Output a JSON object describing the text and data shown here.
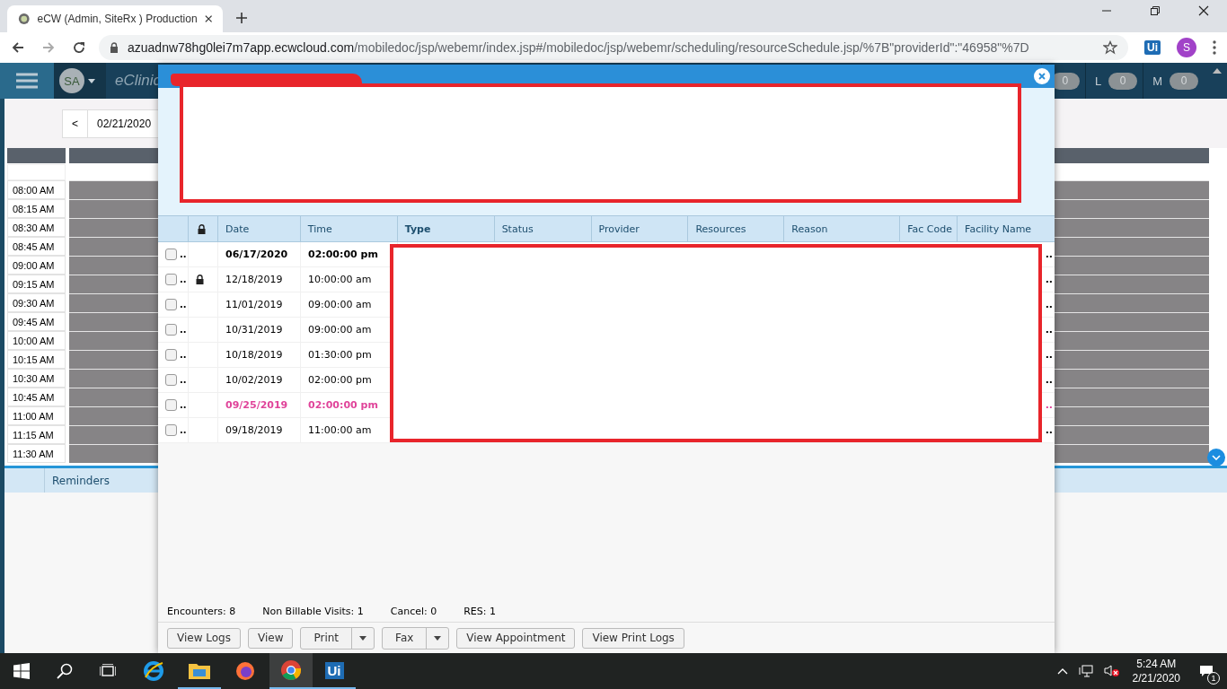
{
  "browser": {
    "tab_title": "eCW (Admin, SiteRx ) Production",
    "url_domain": "azuadnw78hg0lei7m7app.ecwcloud.com",
    "url_path": "/mobiledoc/jsp/webemr/index.jsp#/mobiledoc/jsp/webemr/scheduling/resourceSchedule.jsp/%7B\"providerId\":\"46958\"%7D",
    "extension_label": "Ui",
    "profile_initial": "S"
  },
  "app_header": {
    "user_initials": "SA",
    "product_name": "eClinic",
    "counters": [
      {
        "value": "0"
      },
      {
        "label": "L",
        "value": "0"
      },
      {
        "label": "M",
        "value": "0"
      }
    ]
  },
  "schedule": {
    "prev_button": "<",
    "date": "02/21/2020",
    "times": [
      "08:00 AM",
      "08:15 AM",
      "08:30 AM",
      "08:45 AM",
      "09:00 AM",
      "09:15 AM",
      "09:30 AM",
      "09:45 AM",
      "10:00 AM",
      "10:15 AM",
      "10:30 AM",
      "10:45 AM",
      "11:00 AM",
      "11:15 AM",
      "11:30 AM"
    ]
  },
  "reminders": {
    "heading": "Reminders"
  },
  "dialog": {
    "columns": [
      "Date",
      "Time",
      "Type",
      "Status",
      "Provider",
      "Resources",
      "Reason",
      "Fac Code",
      "Facility Name"
    ],
    "rows": [
      {
        "checked": false,
        "more": "..",
        "locked": false,
        "date": "06/17/2020",
        "time": "02:00:00 pm",
        "bold": true,
        "color": "#000000",
        "tail": ".."
      },
      {
        "checked": false,
        "more": "..",
        "locked": true,
        "date": "12/18/2019",
        "time": "10:00:00 am",
        "bold": false,
        "color": "#000000",
        "tail": ".."
      },
      {
        "checked": false,
        "more": "..",
        "locked": false,
        "date": "11/01/2019",
        "time": "09:00:00 am",
        "bold": false,
        "color": "#000000",
        "tail": ".."
      },
      {
        "checked": false,
        "more": "..",
        "locked": false,
        "date": "10/31/2019",
        "time": "09:00:00 am",
        "bold": false,
        "color": "#000000",
        "tail": ".."
      },
      {
        "checked": false,
        "more": "..",
        "locked": false,
        "date": "10/18/2019",
        "time": "01:30:00 pm",
        "bold": false,
        "color": "#000000",
        "tail": ".."
      },
      {
        "checked": false,
        "more": "..",
        "locked": false,
        "date": "10/02/2019",
        "time": "02:00:00 pm",
        "bold": false,
        "color": "#000000",
        "tail": ".."
      },
      {
        "checked": false,
        "more": "..",
        "locked": false,
        "date": "09/25/2019",
        "time": "02:00:00 pm",
        "bold": true,
        "color": "#e0449a",
        "tail": ".."
      },
      {
        "checked": false,
        "more": "..",
        "locked": false,
        "date": "09/18/2019",
        "time": "11:00:00 am",
        "bold": false,
        "color": "#000000",
        "tail": ".."
      }
    ],
    "stats": [
      "Encounters: 8",
      "Non Billable Visits: 1",
      "Cancel: 0",
      "RES: 1"
    ],
    "buttons": [
      {
        "label": "View Logs",
        "dropdown": false
      },
      {
        "label": "View",
        "dropdown": false
      },
      {
        "label": "Print",
        "dropdown": true
      },
      {
        "label": "Fax",
        "dropdown": true
      },
      {
        "label": "View Appointment",
        "dropdown": false
      },
      {
        "label": "View Print Logs",
        "dropdown": false
      }
    ]
  },
  "taskbar": {
    "app_label": "Ui",
    "time": "5:24 AM",
    "date": "2/21/2020",
    "notification_count": "1"
  }
}
